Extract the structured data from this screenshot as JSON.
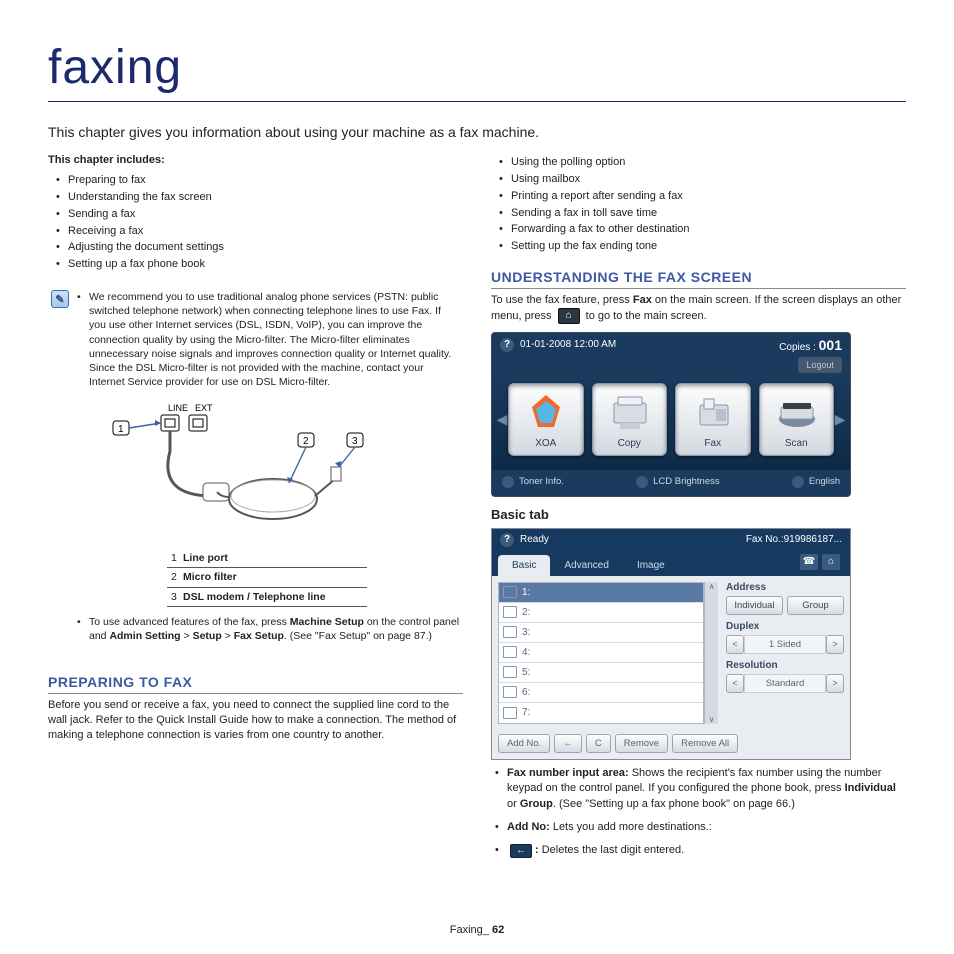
{
  "page": {
    "title": "faxing",
    "intro": "This chapter gives you information about using your machine as a fax machine.",
    "includes_heading": "This chapter includes:",
    "footer_label": "Faxing",
    "footer_page": "62"
  },
  "toc_left": [
    "Preparing to fax",
    "Understanding the fax screen",
    "Sending a fax",
    "Receiving a fax",
    "Adjusting the document settings",
    "Setting up a fax phone book"
  ],
  "toc_right": [
    "Using the polling option",
    "Using mailbox",
    "Printing a report after sending a fax",
    "Sending a fax in toll save time",
    "Forwarding a fax to other destination",
    "Setting up the fax ending tone"
  ],
  "note": {
    "item1": "We recommend you to use traditional analog phone services (PSTN: public switched telephone network) when connecting telephone lines to use Fax. If you use other Internet services (DSL, ISDN, VoIP), you can improve the connection quality by using the Micro-filter. The Micro-filter eliminates unnecessary noise signals and improves connection quality or Internet quality. Since the DSL Micro-filter is not provided with the machine, contact your Internet Service provider for use on DSL Micro-filter.",
    "item2_part1": "To use advanced features of the fax, press ",
    "item2_ms": "Machine Setup",
    "item2_part2": " on the control panel and ",
    "item2_as": "Admin Setting",
    "item2_gt": " > ",
    "item2_setup": "Setup",
    "item2_fs": "Fax Setup",
    "item2_part3": ". (See \"Fax Setup\" on page 87.)"
  },
  "diagram": {
    "line_label": "LINE",
    "ext_label": "EXT",
    "legend": [
      {
        "n": "1",
        "t": "Line port"
      },
      {
        "n": "2",
        "t": "Micro filter"
      },
      {
        "n": "3",
        "t": "DSL modem / Telephone line"
      }
    ]
  },
  "sections": {
    "preparing_h": "PREPARING TO FAX",
    "preparing_p": "Before you send or receive a fax, you need to connect the supplied line cord to the wall jack. Refer to the Quick Install Guide how to make a connection. The method of making a telephone connection is varies from one country to another.",
    "understand_h": "UNDERSTANDING THE FAX SCREEN",
    "understand_p1_a": "To use the fax feature, press ",
    "understand_p1_fax": "Fax",
    "understand_p1_b": " on the main screen. If the screen displays an other menu, press ",
    "understand_p1_c": " to go to the main screen.",
    "basic_h": "Basic tab"
  },
  "screenshot1": {
    "datetime": "01-01-2008 12:00 AM",
    "copies_label": "Copies :",
    "copies_value": "001",
    "logout": "Logout",
    "cards": [
      {
        "label": "XOA"
      },
      {
        "label": "Copy"
      },
      {
        "label": "Fax"
      },
      {
        "label": "Scan"
      }
    ],
    "bottom": [
      "Toner Info.",
      "LCD Brightness",
      "English"
    ]
  },
  "screenshot2": {
    "status": "Ready",
    "faxno": "Fax No.:919986187...",
    "tabs": {
      "basic": "Basic",
      "advanced": "Advanced",
      "image": "Image"
    },
    "rows": [
      "1:",
      "2:",
      "3:",
      "4:",
      "5:",
      "6:",
      "7:"
    ],
    "side": {
      "address": "Address",
      "individual": "Individual",
      "group": "Group",
      "duplex": "Duplex",
      "duplex_val": "1 Sided",
      "resolution": "Resolution",
      "resolution_val": "Standard"
    },
    "foot": {
      "addno": "Add No.",
      "back": "←",
      "c": "C",
      "remove": "Remove",
      "removeall": "Remove All"
    }
  },
  "subnotes": {
    "n1_a": "Fax number input area:",
    "n1_b": " Shows the recipient's fax number using the number keypad on the control panel. If you configured the phone book, press ",
    "n1_ind": "Individual",
    "n1_or": " or ",
    "n1_grp": "Group",
    "n1_c": ". (See \"Setting up a fax phone book\" on page 66.)",
    "n2_a": "Add No:",
    "n2_b": " Lets you add more destinations.:",
    "n3_a": ":",
    "n3_b": " Deletes the last digit entered."
  }
}
